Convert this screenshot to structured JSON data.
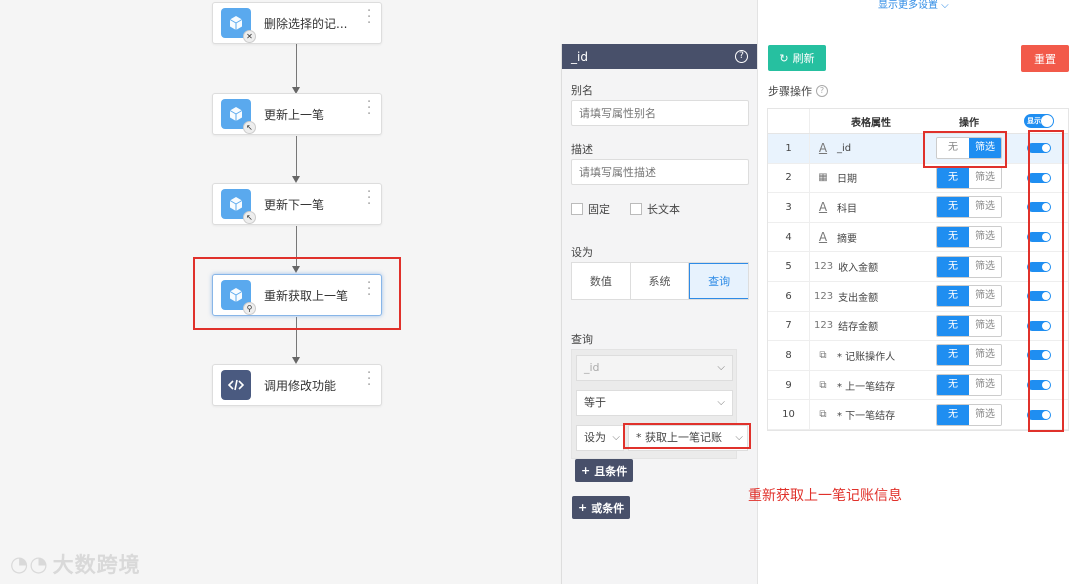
{
  "flow": {
    "nodes": [
      {
        "label": "删除选择的记...",
        "badge": "✕"
      },
      {
        "label": "更新上一笔",
        "badge": "↖"
      },
      {
        "label": "更新下一笔",
        "badge": "↖"
      },
      {
        "label": "重新获取上一笔",
        "badge": "⚲"
      },
      {
        "label": "调用修改功能",
        "badge": ""
      }
    ],
    "watermark": "大数跨境"
  },
  "props": {
    "title": "_id",
    "alias_label": "别名",
    "alias_placeholder": "请填写属性别名",
    "desc_label": "描述",
    "desc_placeholder": "请填写属性描述",
    "fixed_label": "固定",
    "longtext_label": "长文本",
    "setas_label": "设为",
    "setas_options": [
      "数值",
      "系统",
      "查询"
    ],
    "setas_active": "查询",
    "query_label": "查询",
    "query_field": "_id",
    "query_operator": "等于",
    "query_mode": "设为",
    "query_value": "* 获取上一笔记账",
    "and_label": "且条件",
    "or_label": "或条件"
  },
  "right": {
    "more_settings": "显示更多设置",
    "refresh_label": "刷新",
    "reset_label": "重置",
    "step_title": "步骤操作",
    "columns": {
      "attr": "表格属性",
      "op": "操作",
      "show": "显示"
    },
    "op_none": "无",
    "op_filter": "筛选",
    "rows": [
      {
        "num": "1",
        "type": "A",
        "name": "_id",
        "op": "filter"
      },
      {
        "num": "2",
        "type": "cal",
        "name": "日期",
        "op": "none"
      },
      {
        "num": "3",
        "type": "A",
        "name": "科目",
        "op": "none"
      },
      {
        "num": "4",
        "type": "A",
        "name": "摘要",
        "op": "none"
      },
      {
        "num": "5",
        "type": "123",
        "name": "收入金额",
        "op": "none"
      },
      {
        "num": "6",
        "type": "123",
        "name": "支出金额",
        "op": "none"
      },
      {
        "num": "7",
        "type": "123",
        "name": "结存金额",
        "op": "none"
      },
      {
        "num": "8",
        "type": "link",
        "name": "* 记账操作人",
        "op": "none"
      },
      {
        "num": "9",
        "type": "link",
        "name": "* 上一笔结存",
        "op": "none"
      },
      {
        "num": "10",
        "type": "link",
        "name": "* 下一笔结存",
        "op": "none"
      }
    ]
  },
  "annotation": "重新获取上一笔记账信息",
  "colors": {
    "accent": "#1f8ef1",
    "highlight": "#e0312b",
    "refresh": "#26c0a0",
    "reset": "#f25a4a",
    "panel_header": "#48506a"
  }
}
